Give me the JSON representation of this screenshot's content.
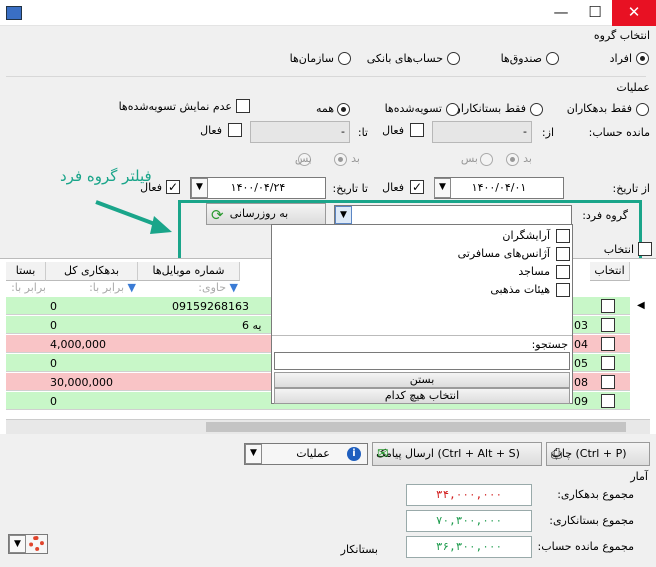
{
  "window": {
    "min": "—",
    "max": "☐",
    "close": "✕"
  },
  "group_select": {
    "title": "انتخاب گروه",
    "options": [
      "افراد",
      "صندوق‌ها",
      "حساب‌های بانکی",
      "سازمان‌ها"
    ],
    "selected": "افراد"
  },
  "operations": {
    "title": "عملیات",
    "options": [
      "فقط بدهکاران",
      "فقط بستانکاران",
      "تسویه‌شده‌ها",
      "همه"
    ],
    "selected": "همه",
    "hide_settled_label": "عدم نمایش تسویه‌شده‌ها"
  },
  "balance": {
    "label": "مانده حساب:",
    "from": "از:",
    "to": "تا:",
    "active": "فعال",
    "bed": "بد",
    "bes": "بس",
    "from_value": "-",
    "to_value": "-"
  },
  "date": {
    "from_label": "از تاریخ:",
    "from_value": "۱۴۰۰/۰۴/۰۱",
    "to_label": "تا تاریخ:",
    "to_value": "۱۴۰۰/۰۴/۲۴",
    "active": "فعال"
  },
  "annotation": {
    "text": "فیلتر گروه فرد",
    "color": "#1aa58a"
  },
  "person_group": {
    "label": "گروه فرد:",
    "refresh_button": "به روزرسانی",
    "items": [
      "آرایشگران",
      "آژانس‌های مسافرتی",
      "مساجد",
      "هیئات مذهبی"
    ],
    "search_label": "جستجو:",
    "close_button": "بستن",
    "select_none_button": "انتخاب هیچ کدام"
  },
  "grid": {
    "select_all_label": "انتخاب",
    "headers": {
      "select": "انتخاب",
      "mobile": "شماره موبایل‌ها",
      "debt": "بدهکاری کل",
      "credit": "بستا"
    },
    "filters": {
      "mobile": "حاوی:",
      "debt": "برابر با:",
      "credit": "برابر با:"
    },
    "rows": [
      {
        "code": "...",
        "mobile": "09159268163",
        "debt": "0",
        "color": "g"
      },
      {
        "code": "03",
        "mobile": "یه 6",
        "debt": "0",
        "color": "g"
      },
      {
        "code": "04",
        "mobile": "",
        "debt": "4,000,000",
        "color": "r"
      },
      {
        "code": "05",
        "mobile": "",
        "debt": "0",
        "color": "g"
      },
      {
        "code": "08",
        "mobile": "",
        "debt": "30,000,000",
        "color": "r"
      },
      {
        "code": "09",
        "mobile": "",
        "debt": "0",
        "color": "g"
      }
    ]
  },
  "toolbar": {
    "print": "(Ctrl + P) چاپ",
    "sms": "(Ctrl + Alt + S) ارسال پیامک",
    "ops": "عملیات"
  },
  "stats": {
    "title": "آمار",
    "debt_label": "مجموع بدهکاری:",
    "debt_value": "۳۴,۰۰۰,۰۰۰",
    "debt_color": "#d11a1a",
    "credit_label": "مجموع بستانکاری:",
    "credit_value": "۷۰,۳۰۰,۰۰۰",
    "credit_color": "#1a9a4a",
    "balance_label": "مجموع مانده حساب:",
    "balance_value": "۳۶,۳۰۰,۰۰۰",
    "balance_color": "#1a9a4a",
    "balance_type": "بستانکار"
  }
}
